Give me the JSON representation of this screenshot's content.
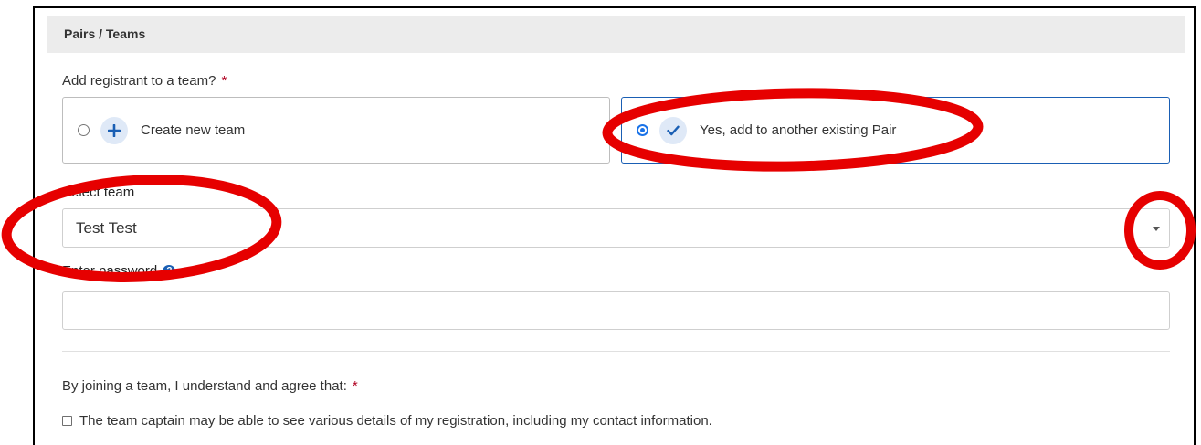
{
  "section": {
    "title": "Pairs / Teams"
  },
  "team_question": {
    "label": "Add registrant to a team?",
    "required_marker": "*",
    "options": [
      {
        "label": "Create new team",
        "icon": "plus-icon",
        "selected": false
      },
      {
        "label": "Yes, add to another existing Pair",
        "icon": "check-icon",
        "selected": true
      }
    ]
  },
  "select_team": {
    "label": "Select team",
    "value": "Test Test",
    "icon": "caret-down-icon"
  },
  "password": {
    "label": "Enter password",
    "help_icon": "question-icon",
    "value": ""
  },
  "agreement": {
    "text": "By joining a team, I understand and agree that:",
    "required_marker": "*",
    "checkbox_label": "The team captain may be able to see various details of my registration, including my contact information.",
    "checked": false
  },
  "annotations": {
    "color": "#e60000",
    "style": "hand-drawn red ellipses"
  },
  "colors": {
    "accent": "#1a5fb4",
    "header_bg": "#ececec",
    "required": "#b00020"
  }
}
